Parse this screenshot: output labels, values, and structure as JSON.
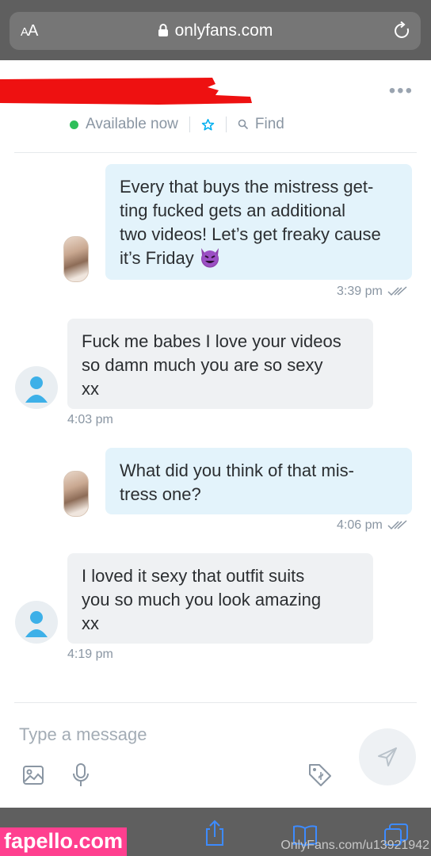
{
  "browser": {
    "aa_label_big": "A",
    "aa_label_small": "A",
    "url": "onlyfans.com"
  },
  "header": {
    "status_text": "Available now",
    "find_label": "Find"
  },
  "messages": [
    {
      "direction": "out",
      "lines": [
        "Every that buys the mistress get-",
        "ting fucked gets an additional",
        "two videos! Let’s get freaky cause",
        "it’s Friday"
      ],
      "emoji": "smiling-devil",
      "time": "3:39 pm"
    },
    {
      "direction": "in",
      "lines": [
        "Fuck me babes I love your videos",
        "so damn much you are so sexy",
        "xx"
      ],
      "time": "4:03 pm"
    },
    {
      "direction": "out",
      "lines": [
        "What did you think of that mis-",
        "tress one?"
      ],
      "time": "4:06 pm"
    },
    {
      "direction": "in",
      "lines": [
        "I loved it sexy that outfit suits",
        "you so much you look amazing",
        "xx"
      ],
      "time": "4:19 pm"
    }
  ],
  "compose": {
    "placeholder": "Type a message"
  },
  "watermarks": {
    "left": "fapello.com",
    "right": "OnlyFans.com/u13921942"
  },
  "colors": {
    "accent": "#00aff0",
    "online": "#2fbf5a",
    "outgoing_bubble": "#e3f3fb",
    "incoming_bubble": "#eff1f3",
    "redaction": "#ee1111"
  }
}
